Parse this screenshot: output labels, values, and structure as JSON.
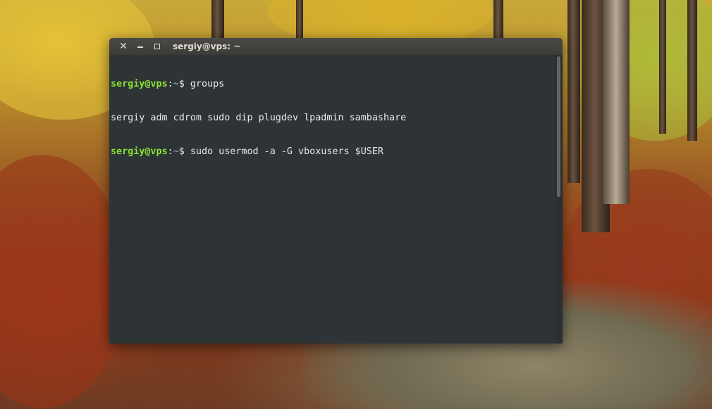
{
  "window": {
    "title": "sergiy@vps: ~",
    "close_icon": "close-icon",
    "minimize_icon": "minimize-icon",
    "maximize_icon": "maximize-icon"
  },
  "terminal": {
    "lines": [
      {
        "user_host": "sergiy@vps",
        "colon": ":",
        "path": "~",
        "prompt_symbol": "$ ",
        "command": "groups"
      },
      {
        "output": "sergiy adm cdrom sudo dip plugdev lpadmin sambashare"
      },
      {
        "user_host": "sergiy@vps",
        "colon": ":",
        "path": "~",
        "prompt_symbol": "$ ",
        "command": "sudo usermod -a -G vboxusers $USER"
      }
    ],
    "colors": {
      "background": "#2e3436",
      "prompt_user": "#8ae234",
      "prompt_path": "#729fcf",
      "text": "#e8e8e6"
    }
  }
}
